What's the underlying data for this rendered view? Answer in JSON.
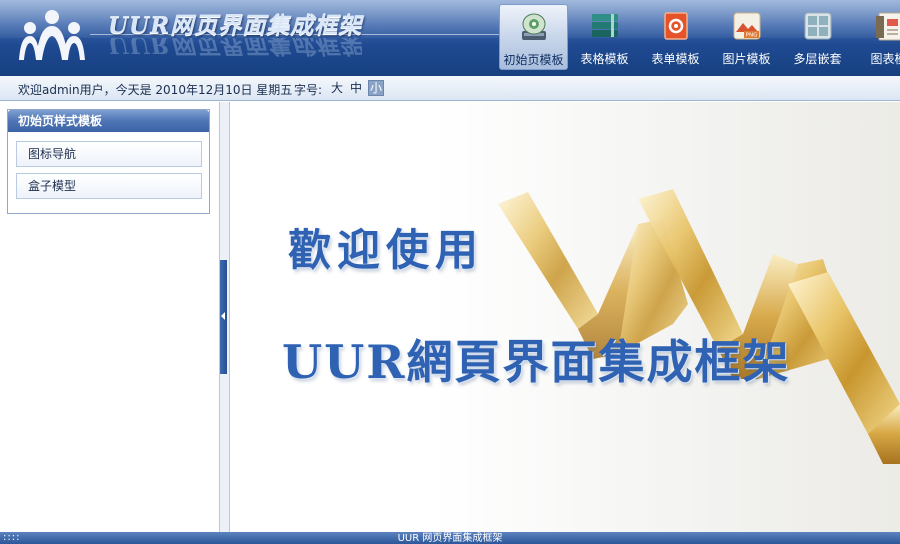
{
  "header": {
    "app_title": "UUR网页界面集成框架",
    "nav": [
      {
        "label": "初始页模板",
        "icon": "monitor-disc-icon",
        "active": true
      },
      {
        "label": "表格模板",
        "icon": "stacked-books-icon",
        "active": false
      },
      {
        "label": "表单模板",
        "icon": "gear-form-icon",
        "active": false
      },
      {
        "label": "图片模板",
        "icon": "png-image-icon",
        "active": false
      },
      {
        "label": "多层嵌套",
        "icon": "grid-windows-icon",
        "active": false
      },
      {
        "label": "图表模",
        "icon": "chart-document-icon",
        "active": false
      }
    ]
  },
  "infobar": {
    "welcome": "欢迎admin用户，今天是 2010年12月10日 星期五",
    "font_size_label": "字号:",
    "font_sizes": [
      "大",
      "中",
      "小"
    ],
    "font_size_selected": "小"
  },
  "sidebar": {
    "title": "初始页样式模板",
    "items": [
      {
        "label": "图标导航"
      },
      {
        "label": "盒子模型"
      }
    ]
  },
  "main": {
    "welcome_line1": "歡迎使用",
    "welcome_line2": "UUR網頁界面集成框架"
  },
  "footer": {
    "text": "UUR 网页界面集成框架",
    "grip": "::::"
  },
  "colors": {
    "header_dark": "#16407f",
    "accent_blue": "#2f62b2",
    "menu_header": "#4f75b5"
  }
}
